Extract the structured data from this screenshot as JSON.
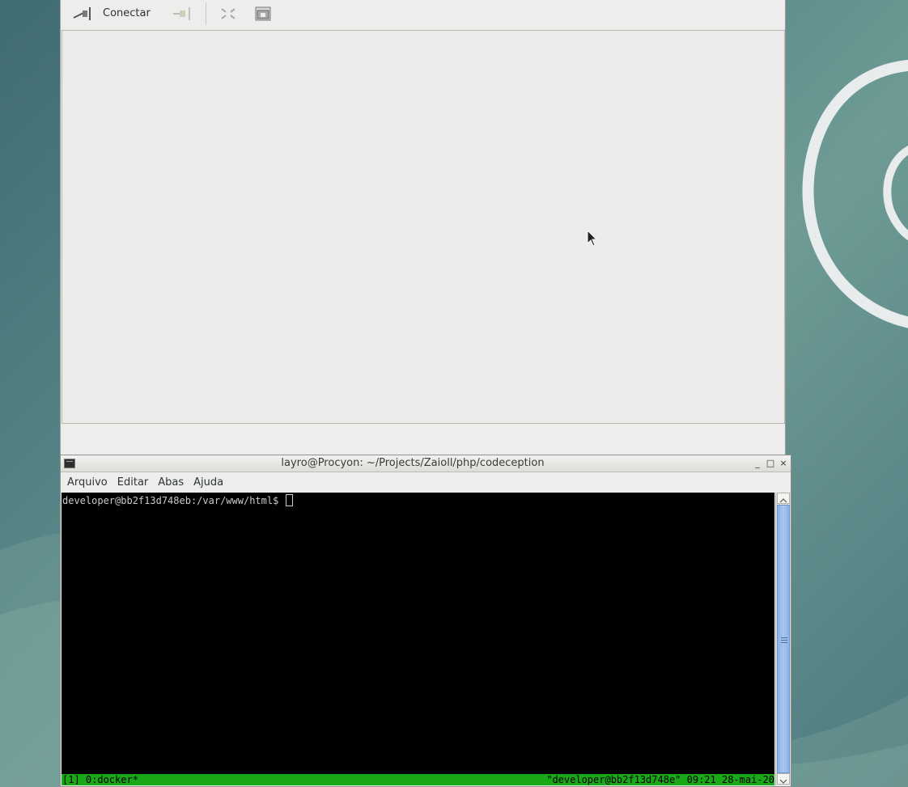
{
  "viewer": {
    "toolbar": {
      "connect_label": "Conectar"
    }
  },
  "terminal": {
    "title": "layro@Procyon: ~/Projects/Zaioll/php/codeception",
    "menu": [
      "Arquivo",
      "Editar",
      "Abas",
      "Ajuda"
    ],
    "prompt": "developer@bb2f13d748eb:/var/www/html$ ",
    "status_left": "[1] 0:docker*",
    "status_right": "\"developer@bb2f13d748e\" 09:21 28-mai-20",
    "status_color": "#18a818",
    "window_controls": [
      "_",
      "□",
      "×"
    ]
  },
  "icons": {
    "connect": "plug-connect-icon",
    "disconnect": "plug-disconnect-icon",
    "fullscreen": "fullscreen-icon",
    "screenshot": "screenshot-icon"
  }
}
